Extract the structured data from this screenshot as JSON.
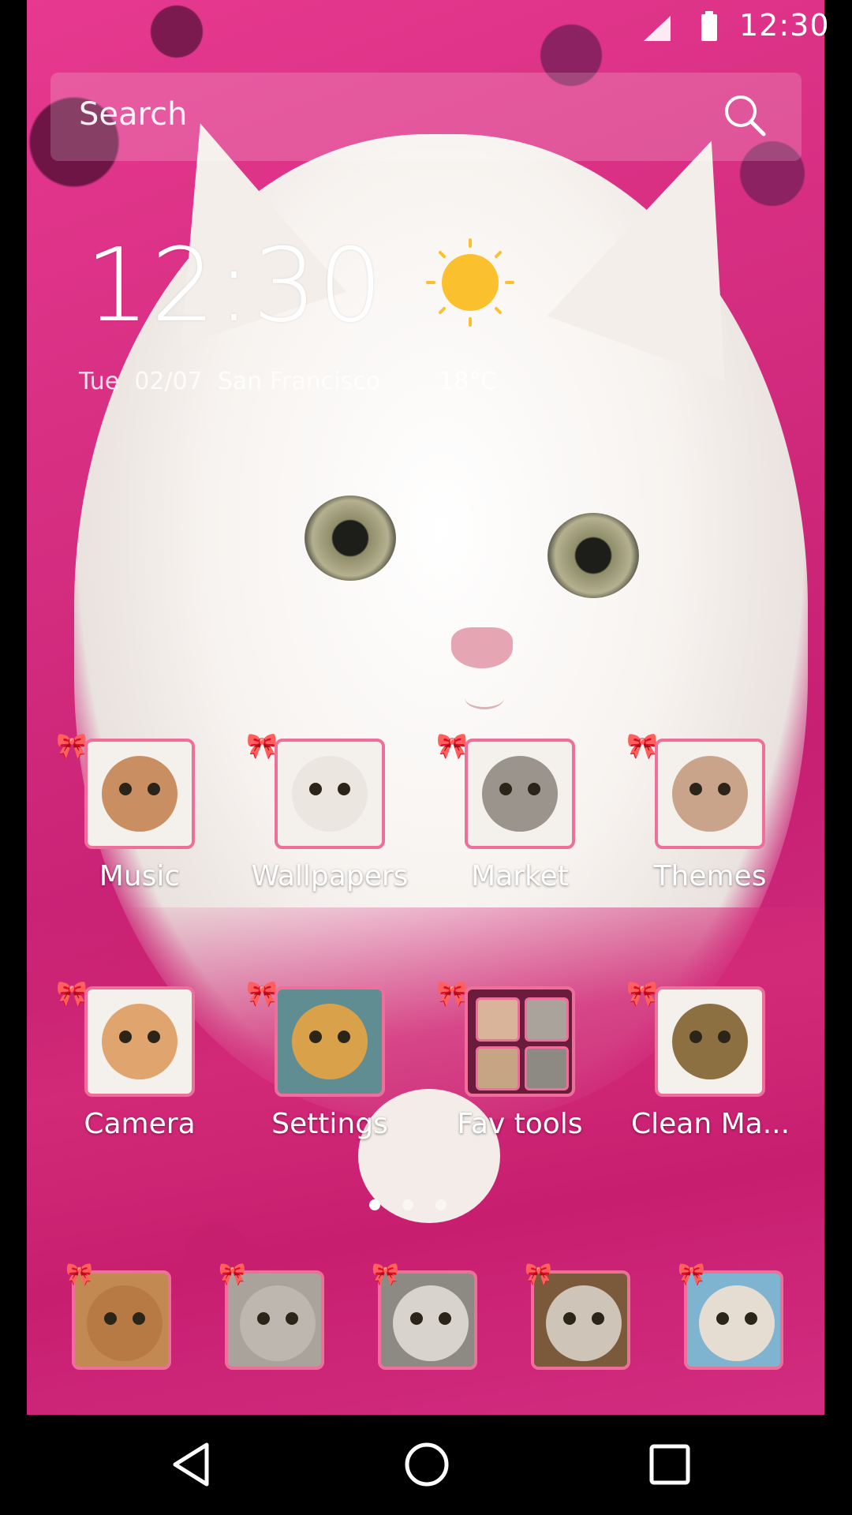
{
  "status_bar": {
    "time": "12:30"
  },
  "search": {
    "placeholder": "Search"
  },
  "clock_widget": {
    "time": "12:30",
    "date_city": "Tue  02/07  San Francisco",
    "temperature": "18°C",
    "weather": "sun-icon"
  },
  "apps_row1": [
    {
      "label": "Music",
      "color": "#c98f62"
    },
    {
      "label": "Wallpapers",
      "color": "#f3f0ee"
    },
    {
      "label": "Market",
      "color": "#9a948c"
    },
    {
      "label": "Themes",
      "color": "#c9a48a"
    }
  ],
  "apps_row2": [
    {
      "label": "Camera",
      "color": "#e0a56f"
    },
    {
      "label": "Settings",
      "color": "#d9a24a"
    },
    {
      "label": "Fav tools",
      "color": "#6b1b3c"
    },
    {
      "label": "Clean Ma...",
      "color": "#8d7042"
    }
  ],
  "page_indicator": {
    "pages": 3,
    "current": 1
  },
  "dock": [
    {
      "name": "dock-app-1",
      "color": "#c28a52"
    },
    {
      "name": "dock-app-2",
      "color": "#a9a39b"
    },
    {
      "name": "dock-app-3",
      "color": "#8d8a84"
    },
    {
      "name": "dock-app-4",
      "color": "#7a5a3a"
    },
    {
      "name": "dock-app-5",
      "color": "#d9d2c9"
    }
  ],
  "colors": {
    "accent": "#ee6f9a",
    "background": "#d12a7d",
    "sun": "#fbc02d"
  }
}
